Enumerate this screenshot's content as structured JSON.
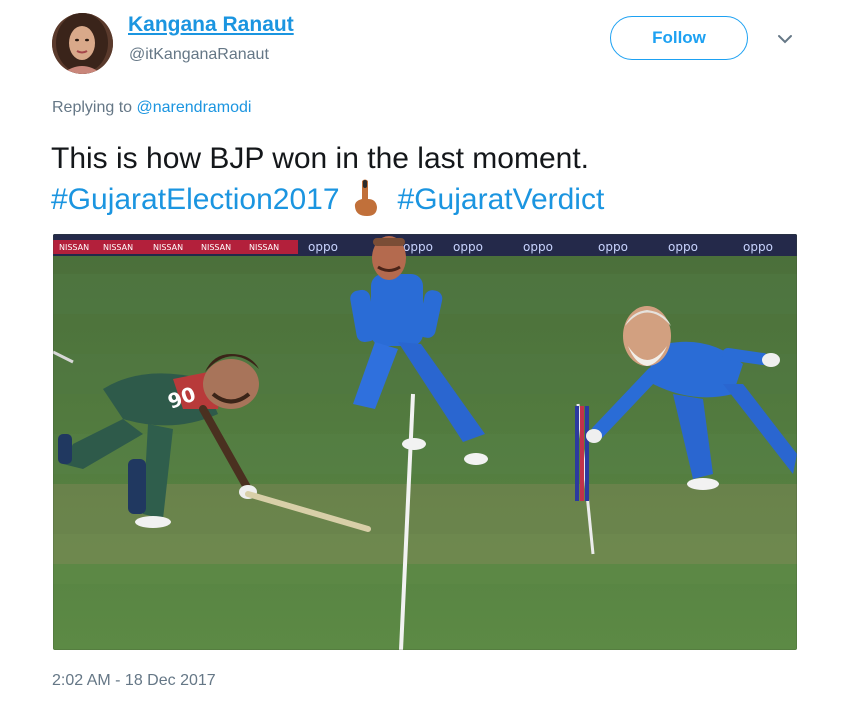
{
  "author": {
    "display_name": "Kangana Ranaut",
    "handle": "@itKanganaRanaut"
  },
  "follow_label": "Follow",
  "reply": {
    "prefix": "Replying to",
    "mention": "@narendramodi"
  },
  "tweet": {
    "text": "This is how BJP won in the last moment.",
    "hashtag_1": "#GujaratElection2017",
    "hashtag_2": "#GujaratVerdict",
    "emoji": "ink-finger-up-icon"
  },
  "media": {
    "description_icon": "cricket-run-out-photo",
    "boards": [
      "NISSAN",
      "NISSAN",
      "NISSAN",
      "NISSAN",
      "NISSAN",
      "oppo",
      "oppo",
      "oppo",
      "oppo",
      "oppo",
      "oppo",
      "oppo"
    ],
    "jersey_number": "90"
  },
  "timestamp": "2:02 AM - 18 Dec 2017",
  "colors": {
    "link_blue": "#1b95e0",
    "follow_blue": "#1da1f2",
    "grey_text": "#657786",
    "field_green": "#4f7a3a"
  }
}
